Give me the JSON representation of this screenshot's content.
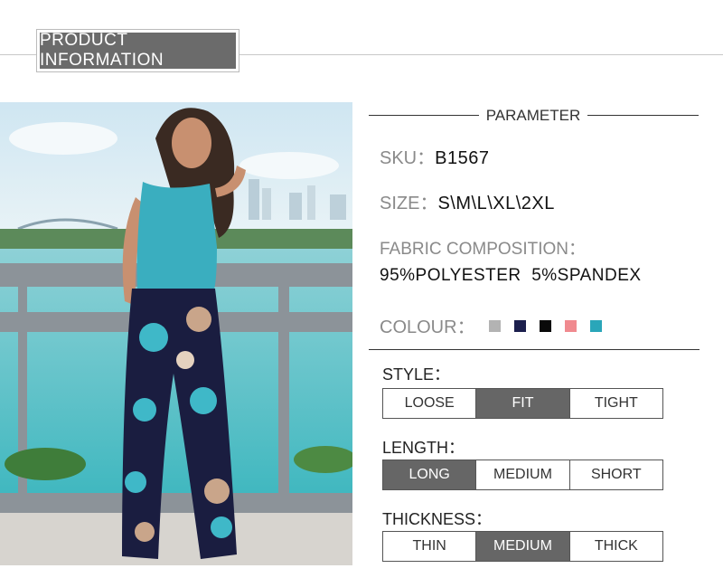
{
  "header": {
    "title": "PRODUCT  INFORMATION"
  },
  "parameter": {
    "title": "PARAMETER",
    "sku_label": "SKU：",
    "sku_value": "B1567",
    "size_label": "SIZE：",
    "size_value": "S\\M\\L\\XL\\2XL",
    "fabric_label": "FABRIC COMPOSITION：",
    "fabric_value": "95%POLYESTER  5%SPANDEX",
    "colour_label": "COLOUR：",
    "colours": [
      "#b3b3b3",
      "#1c1f4d",
      "#0a0a0a",
      "#f08a8f",
      "#2aa6b9"
    ]
  },
  "style": {
    "label": "STYLE：",
    "options": [
      "LOOSE",
      "FIT",
      "TIGHT"
    ],
    "selected": "FIT"
  },
  "length": {
    "label": "LENGTH：",
    "options": [
      "LONG",
      "MEDIUM",
      "SHORT"
    ],
    "selected": "LONG"
  },
  "thickness": {
    "label": "THICKNESS：",
    "options": [
      "THIN",
      "MEDIUM",
      "THICK"
    ],
    "selected": "MEDIUM"
  }
}
